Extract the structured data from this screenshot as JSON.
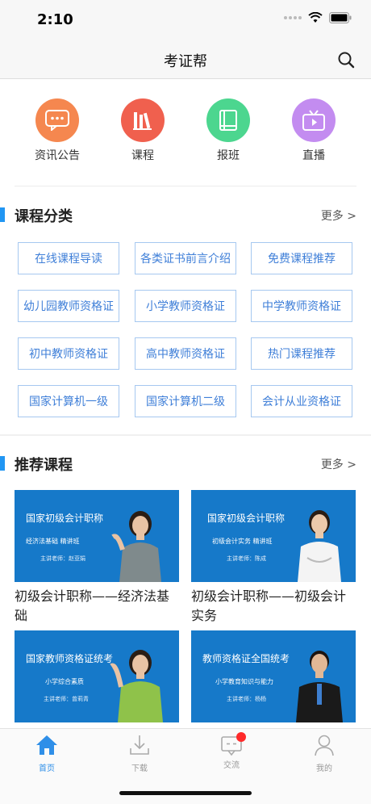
{
  "status": {
    "time": "2:10"
  },
  "nav": {
    "title": "考证帮"
  },
  "quick_menu": [
    {
      "label": "资讯公告",
      "color": "#f5874f",
      "icon": "chat-bubble-icon"
    },
    {
      "label": "课程",
      "color": "#f0604e",
      "icon": "books-icon"
    },
    {
      "label": "报班",
      "color": "#4cd68f",
      "icon": "notebook-icon"
    },
    {
      "label": "直播",
      "color": "#c38cf0",
      "icon": "tv-icon"
    }
  ],
  "categories_section": {
    "title": "课程分类",
    "more": "更多 >",
    "items": [
      "在线课程导读",
      "各类证书前言介绍",
      "免费课程推荐",
      "幼儿园教师资格证",
      "小学教师资格证",
      "中学教师资格证",
      "初中教师资格证",
      "高中教师资格证",
      "热门课程推荐",
      "国家计算机一级",
      "国家计算机二级",
      "会计从业资格证"
    ]
  },
  "recommend_section": {
    "title": "推荐课程",
    "more": "更多 >",
    "courses": [
      {
        "thumb_title": "国家初级会计职称",
        "thumb_sub": "经济法基础   精讲班",
        "thumb_teacher": "主讲老师：赵亚娟",
        "title": "初级会计职称——经济法基础"
      },
      {
        "thumb_title": "国家初级会计职称",
        "thumb_sub": "初级会计实务   精讲班",
        "thumb_teacher": "主讲老师：陈成",
        "title": "初级会计职称——初级会计实务"
      },
      {
        "thumb_title": "国家教师资格证统考",
        "thumb_sub": "小学综合素质",
        "thumb_teacher": "主讲老师：曾莉青",
        "title": ""
      },
      {
        "thumb_title": "教师资格证全国统考",
        "thumb_sub": "小学教育知识与能力",
        "thumb_teacher": "主讲老师：杨杨",
        "title": ""
      }
    ]
  },
  "tabs": [
    {
      "label": "首页",
      "active": true
    },
    {
      "label": "下载",
      "active": false
    },
    {
      "label": "交流",
      "active": false
    },
    {
      "label": "我的",
      "active": false
    }
  ],
  "colors": {
    "accent": "#2196f3",
    "thumb_bg": "#1679c9",
    "badge": "#ff2a2a"
  }
}
